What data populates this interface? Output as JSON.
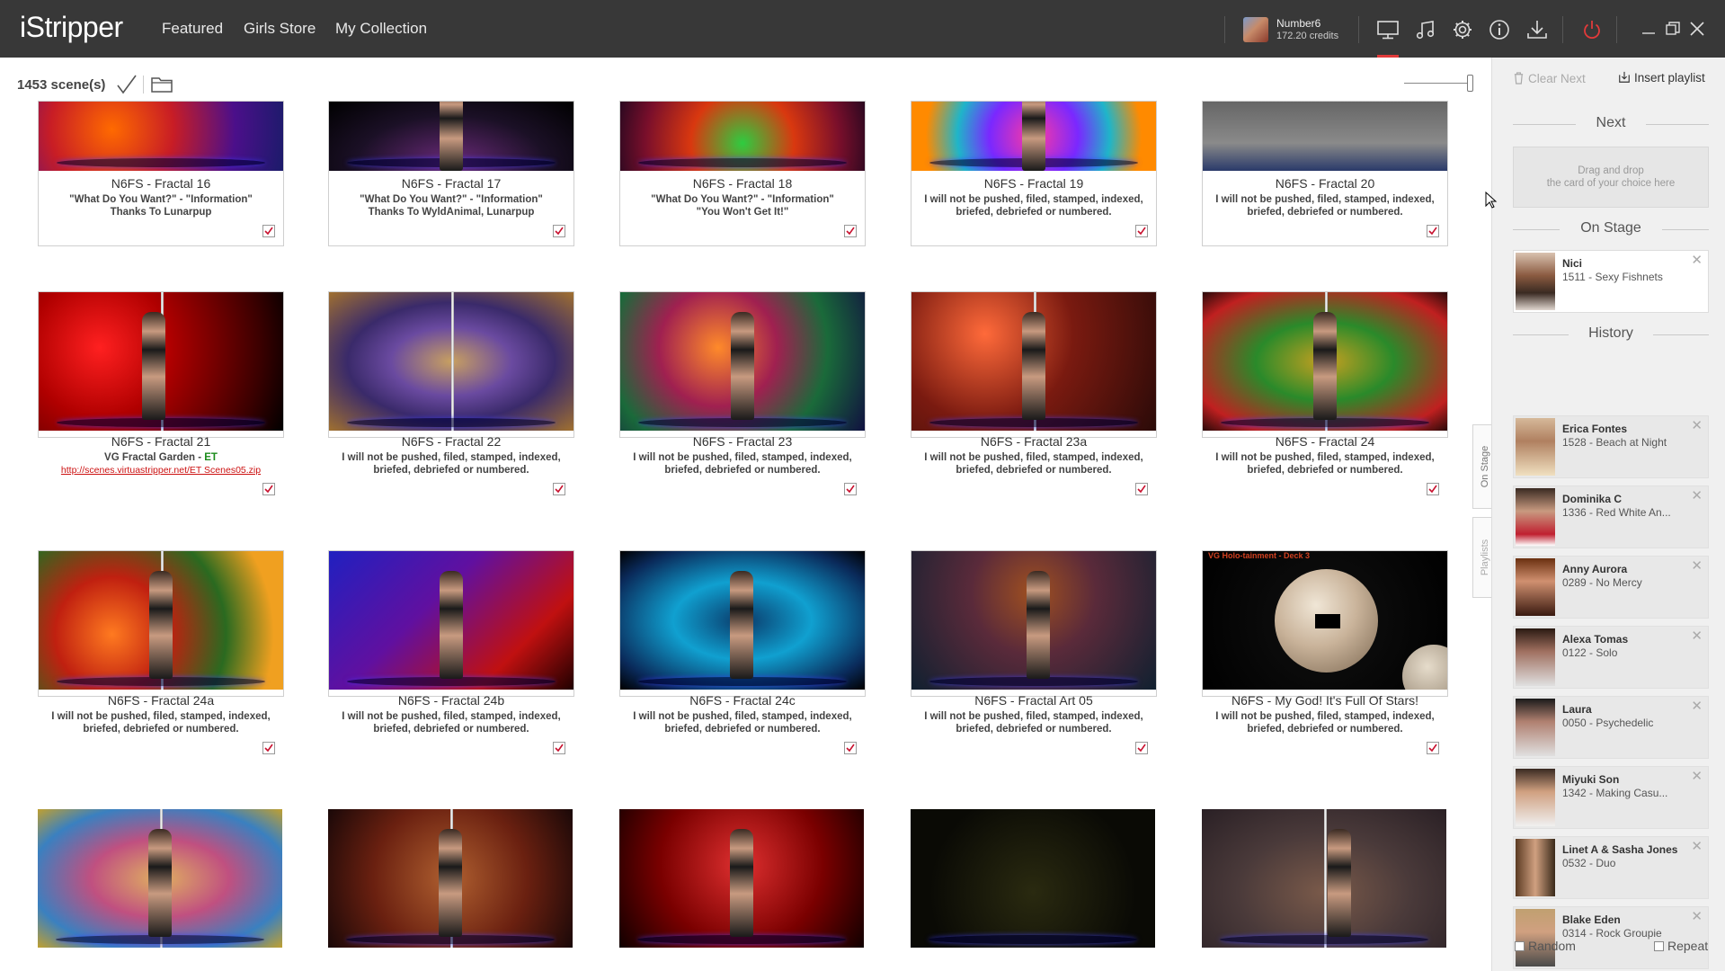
{
  "app": {
    "logo": "iStripper"
  },
  "nav": {
    "featured": "Featured",
    "girls_store": "Girls Store",
    "my_collection": "My Collection"
  },
  "user": {
    "name": "Number6",
    "credits": "172.20 credits"
  },
  "icons": [
    "display-icon",
    "music-icon",
    "gear-icon",
    "info-icon",
    "download-icon",
    "power-icon",
    "minimize-icon",
    "restore-icon",
    "close-icon"
  ],
  "toolbar": {
    "scene_count": "1453 scene(s)"
  },
  "cards": [
    {
      "title": "N6FS - Fractal 16",
      "desc1": "\"What Do You Want?\" - \"Information\"",
      "desc2": "Thanks To Lunarpup",
      "theme": "fractal16",
      "top": true
    },
    {
      "title": "N6FS - Fractal 17",
      "desc1": "\"What Do You Want?\" - \"Information\"",
      "desc2": "Thanks To WyldAnimal, Lunarpup",
      "theme": "fractal17",
      "top": true
    },
    {
      "title": "N6FS - Fractal 18",
      "desc1": "\"What Do You Want?\" - \"Information\"",
      "desc2": "\"You Won't Get It!\"",
      "theme": "fractal18",
      "top": true
    },
    {
      "title": "N6FS - Fractal 19",
      "desc1": "I will not be pushed, filed, stamped, indexed,",
      "desc2": "briefed, debriefed or numbered.",
      "theme": "fractal19",
      "top": true
    },
    {
      "title": "N6FS - Fractal 20",
      "desc1": "I will not be pushed, filed, stamped, indexed,",
      "desc2": "briefed, debriefed or numbered.",
      "theme": "fractal20",
      "top": true
    },
    {
      "title": "N6FS - Fractal 21",
      "desc1": "VG Fractal Garden - ",
      "desc1_et": "ET",
      "link": "http://scenes.virtuastripper.net/ET Scenes05.zip",
      "theme": "fractal21"
    },
    {
      "title": "N6FS - Fractal 22",
      "desc1": "I will not be pushed, filed, stamped, indexed,",
      "desc2": "briefed, debriefed or numbered.",
      "theme": "fractal22"
    },
    {
      "title": "N6FS - Fractal 23",
      "desc1": "I will not be pushed, filed, stamped, indexed,",
      "desc2": "briefed, debriefed or numbered.",
      "theme": "fractal23"
    },
    {
      "title": "N6FS - Fractal 23a",
      "desc1": "I will not be pushed, filed, stamped, indexed,",
      "desc2": "briefed, debriefed or numbered.",
      "theme": "fractal23a"
    },
    {
      "title": "N6FS - Fractal 24",
      "desc1": "I will not be pushed, filed, stamped, indexed,",
      "desc2": "briefed, debriefed or numbered.",
      "theme": "fractal24"
    },
    {
      "title": "N6FS - Fractal 24a",
      "desc1": "I will not be pushed, filed, stamped, indexed,",
      "desc2": "briefed, debriefed or numbered.",
      "theme": "fractal24a"
    },
    {
      "title": "N6FS - Fractal 24b",
      "desc1": "I will not be pushed, filed, stamped, indexed,",
      "desc2": "briefed, debriefed or numbered.",
      "theme": "fractal24b"
    },
    {
      "title": "N6FS - Fractal 24c",
      "desc1": "I will not be pushed, filed, stamped, indexed,",
      "desc2": "briefed, debriefed or numbered.",
      "theme": "fractal24c"
    },
    {
      "title": "N6FS - Fractal Art 05",
      "desc1": "I will not be pushed, filed, stamped, indexed,",
      "desc2": "briefed, debriefed or numbered.",
      "theme": "art05"
    },
    {
      "title": "N6FS - My God! It's Full Of Stars!",
      "desc1": "I will not be pushed, filed, stamped, indexed,",
      "desc2": "briefed, debriefed or numbered.",
      "theme": "stars",
      "overlay": "VG Holo-tainment - Deck 3"
    },
    {
      "title": "",
      "theme": "row4a",
      "bottom": true
    },
    {
      "title": "",
      "theme": "row4b",
      "bottom": true
    },
    {
      "title": "",
      "theme": "row4c",
      "bottom": true
    },
    {
      "title": "",
      "theme": "row4d",
      "bottom": true
    },
    {
      "title": "",
      "theme": "row4e",
      "bottom": true
    }
  ],
  "side_tabs": {
    "on_stage": "On Stage",
    "playlists": "Playlists"
  },
  "panel": {
    "clear_next": "Clear Next",
    "insert_playlist": "Insert playlist",
    "next_label": "Next",
    "drop_line1": "Drag and drop",
    "drop_line2": "the card of your choice here",
    "on_stage_label": "On Stage",
    "history_label": "History",
    "random": "Random",
    "repeat": "Repeat"
  },
  "on_stage": {
    "name": "Nici",
    "scene": "1511 - Sexy Fishnets"
  },
  "history": [
    {
      "name": "Erica Fontes",
      "scene": "1528 - Beach at Night"
    },
    {
      "name": "Dominika C",
      "scene": "1336 - Red White An..."
    },
    {
      "name": "Anny Aurora",
      "scene": "0289 - No Mercy"
    },
    {
      "name": "Alexa Tomas",
      "scene": "0122 - Solo"
    },
    {
      "name": "Laura",
      "scene": "0050 - Psychedelic"
    },
    {
      "name": "Miyuki Son",
      "scene": "1342 - Making Casu..."
    },
    {
      "name": "Linet A & Sasha Jones",
      "scene": "0532 - Duo"
    },
    {
      "name": "Blake Eden",
      "scene": "0314 - Rock Groupie"
    }
  ]
}
